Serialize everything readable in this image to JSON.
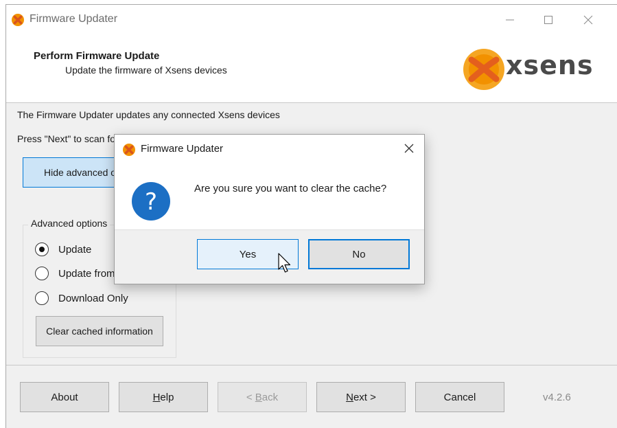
{
  "window": {
    "title": "Firmware Updater",
    "controls": {
      "minimize_icon": "minimize-icon",
      "maximize_icon": "maximize-icon",
      "close_icon": "close-icon"
    }
  },
  "header": {
    "title": "Perform Firmware Update",
    "subtitle": "Update the firmware of Xsens devices",
    "logo_text": "xsens",
    "logo_colors": {
      "orange": "#f29100",
      "dark": "#4a4a4a"
    }
  },
  "main": {
    "intro": "The Firmware Updater updates any connected Xsens devices",
    "press_text": "Press \"Next\" to scan for devices.",
    "advanced_toggle_label": "Hide advanced options",
    "advanced": {
      "group_label": "Advanced options",
      "options": [
        {
          "label": "Update",
          "checked": true
        },
        {
          "label": "Update from file",
          "checked": false
        },
        {
          "label": "Download Only",
          "checked": false
        }
      ],
      "clear_button_label": "Clear cached information"
    }
  },
  "footer": {
    "about_label": "About",
    "help_label_prefix": "",
    "help_label_underlined": "H",
    "help_label_rest": "elp",
    "back_label_prefix": "< ",
    "back_label_underlined": "B",
    "back_label_rest": "ack",
    "next_label_underlined": "N",
    "next_label_rest": "ext >",
    "cancel_label": "Cancel",
    "version": "v4.2.6"
  },
  "dialog": {
    "title": "Firmware Updater",
    "message": "Are you sure you want to clear the cache?",
    "yes_label": "Yes",
    "no_label": "No",
    "icon": "question-icon",
    "accent_color": "#0078d7"
  }
}
